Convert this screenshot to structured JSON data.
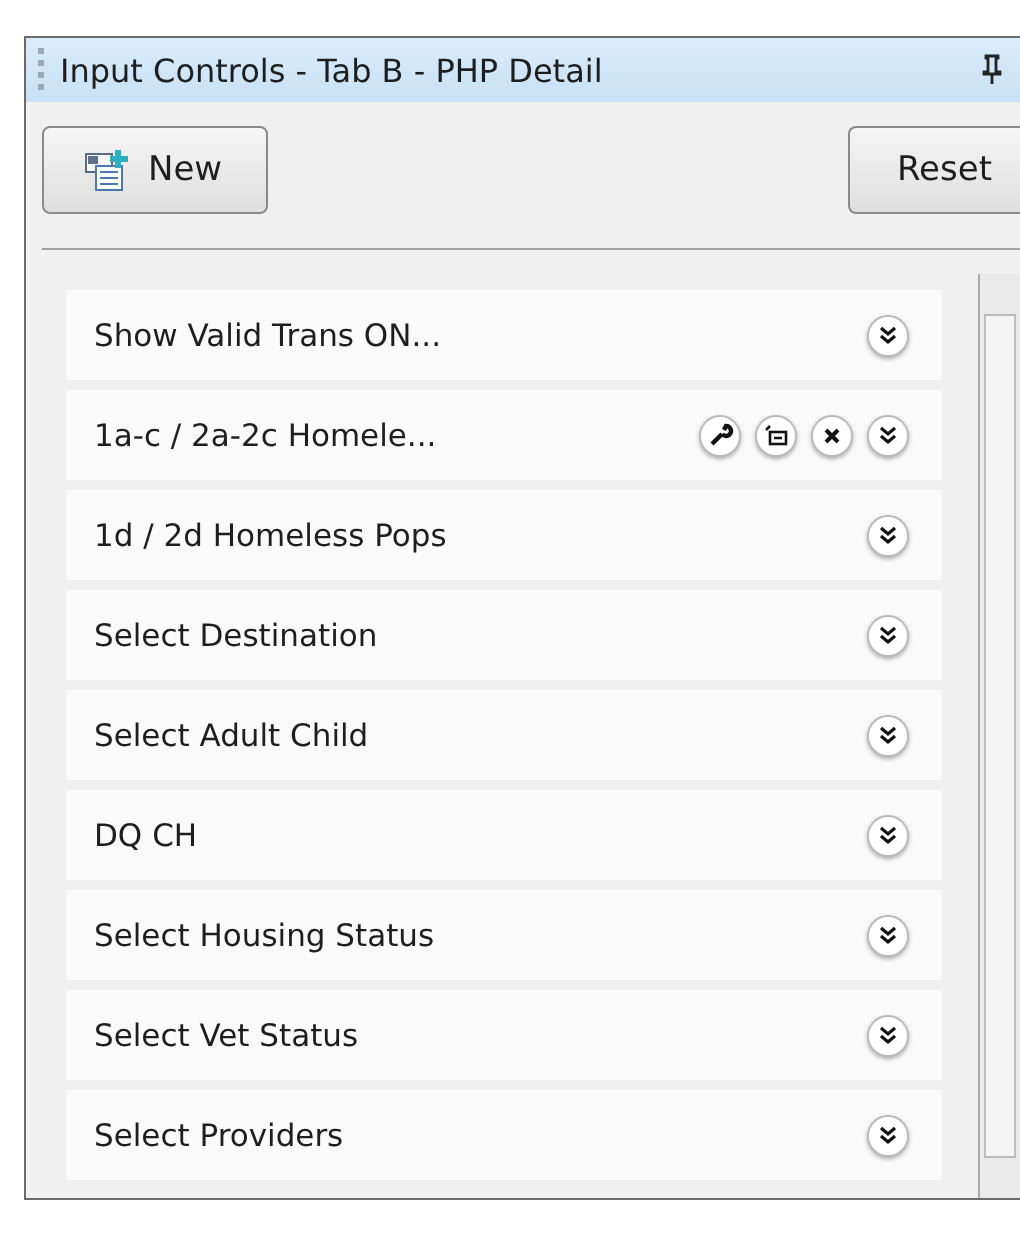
{
  "panel": {
    "title": "Input Controls - Tab B - PHP Detail"
  },
  "toolbar": {
    "new_label": "New",
    "reset_label": "Reset"
  },
  "controls": [
    {
      "label": "Show Valid Trans ON...",
      "tools": false
    },
    {
      "label": "1a-c / 2a-2c  Homele...",
      "tools": true
    },
    {
      "label": "1d / 2d Homeless Pops",
      "tools": false
    },
    {
      "label": "Select Destination",
      "tools": false
    },
    {
      "label": "Select Adult Child",
      "tools": false
    },
    {
      "label": "DQ CH",
      "tools": false
    },
    {
      "label": "Select Housing Status",
      "tools": false
    },
    {
      "label": "Select Vet Status",
      "tools": false
    },
    {
      "label": "Select Providers",
      "tools": false
    }
  ]
}
